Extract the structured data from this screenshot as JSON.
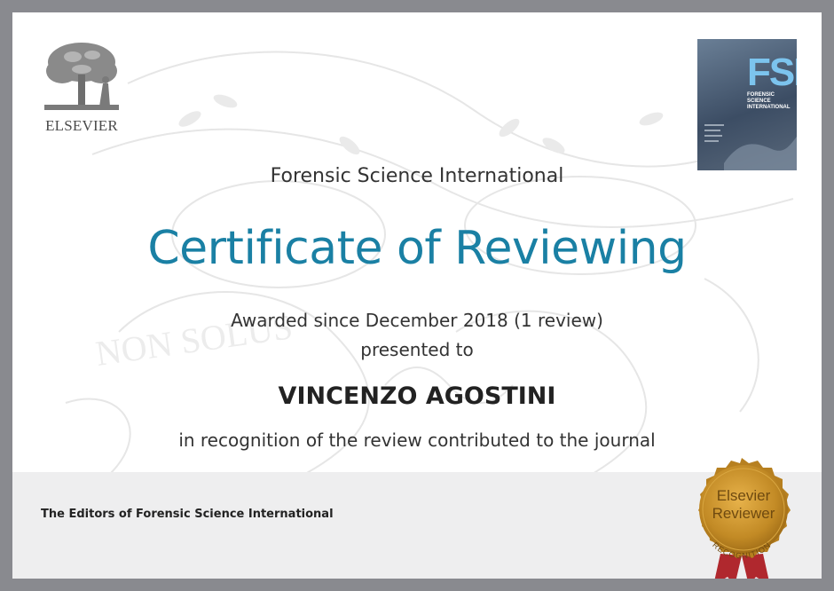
{
  "publisher": {
    "name": "ELSEVIER"
  },
  "journal_cover": {
    "abbr": "FSI",
    "name": "FORENSIC SCIENCE INTERNATIONAL"
  },
  "certificate": {
    "journal": "Forensic Science International",
    "title": "Certificate of Reviewing",
    "awarded": "Awarded since December 2018 (1 review)",
    "presented_to": "presented to",
    "recipient": "VINCENZO AGOSTINI",
    "recognition": "in recognition of the review contributed to the journal",
    "signatory": "The Editors of Forensic Science International"
  },
  "seal": {
    "line1": "Elsevier",
    "line2": "Reviewer",
    "arc": "RECOGNITION"
  },
  "watermark": {
    "motto": "NON SOLUS"
  },
  "colors": {
    "title": "#1a80a4",
    "seal_gold": "#c8902a",
    "ribbon": "#b0282e",
    "frame": "#898a8f"
  }
}
